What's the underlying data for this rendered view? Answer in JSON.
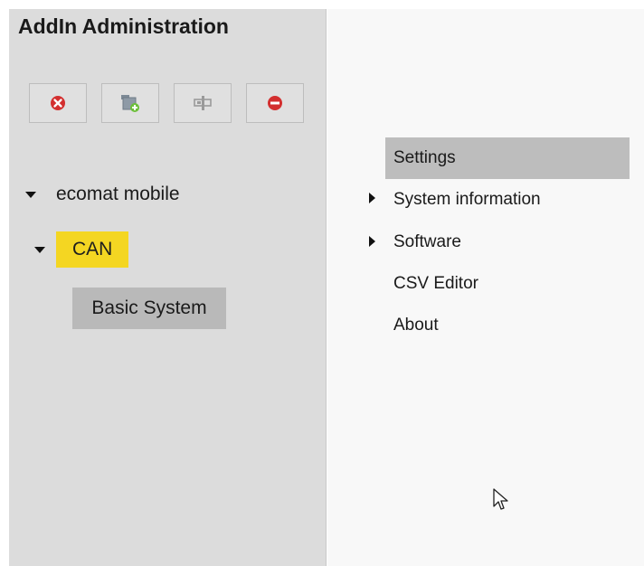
{
  "app": {
    "title": "AddIn Administration"
  },
  "toolbar": {
    "buttons": [
      {
        "icon": "close-circle-icon"
      },
      {
        "icon": "add-folder-icon"
      },
      {
        "icon": "settings-icon"
      },
      {
        "icon": "remove-icon"
      }
    ]
  },
  "tree": {
    "root": {
      "label": "ecomat mobile"
    },
    "can": {
      "label": "CAN"
    },
    "basic": {
      "label": "Basic System"
    }
  },
  "menu": {
    "items": [
      {
        "label": "Settings"
      },
      {
        "label": "System information"
      },
      {
        "label": "Software"
      },
      {
        "label": "CSV Editor"
      },
      {
        "label": "About"
      }
    ]
  },
  "colors": {
    "panel_left": "#dcdcdc",
    "can_highlight": "#f4d622",
    "selected_bg": "#b9b9b9",
    "menu_selected": "#bdbdbd",
    "red_icon": "#d32f2f"
  }
}
